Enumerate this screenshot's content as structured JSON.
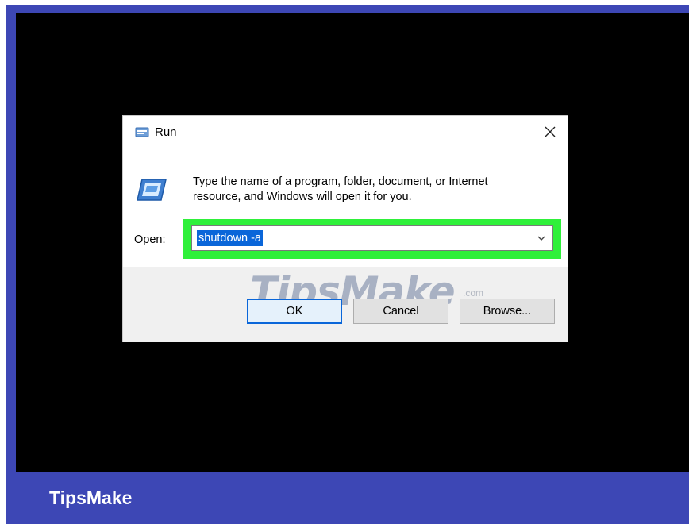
{
  "brand": {
    "name": "TipsMake"
  },
  "dialog": {
    "title": "Run",
    "title_icon": "run-icon",
    "close_icon": "close-icon",
    "program_icon": "program-window-icon",
    "description_line1": "Type the name of a program, folder, document, or Internet",
    "description_line2": "resource, and Windows will open it for you.",
    "open_label": "Open:",
    "open_value": "shutdown -a",
    "dropdown_icon": "chevron-down-icon",
    "watermark": "TipsMake",
    "watermark_suffix": ".com",
    "buttons": {
      "ok": "OK",
      "cancel": "Cancel",
      "browse": "Browse..."
    }
  },
  "colors": {
    "frame": "#3d47b5",
    "highlight": "#2ff03a",
    "selection": "#0a66d9"
  }
}
